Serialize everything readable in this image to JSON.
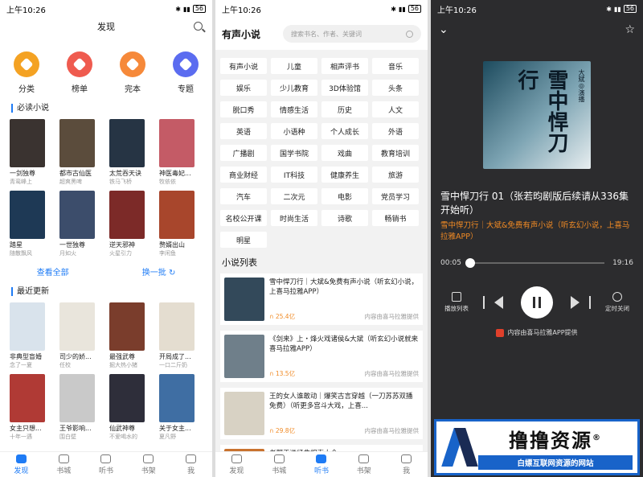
{
  "status_time": "上午10:26",
  "battery": "56",
  "discover": {
    "title": "发现",
    "categories": [
      {
        "label": "分类",
        "color": "#f4a223"
      },
      {
        "label": "榜单",
        "color": "#ef5b4f"
      },
      {
        "label": "完本",
        "color": "#f6893a"
      },
      {
        "label": "专题",
        "color": "#5b6cf0"
      }
    ],
    "must_read_title": "必读小说",
    "must_read": [
      {
        "title": "一剑独尊",
        "author": "青鸾峰上",
        "color": "#3a3330"
      },
      {
        "title": "都市古仙医",
        "author": "超爽黑啤",
        "color": "#5b4c3c"
      },
      {
        "title": "太荒吞天诀",
        "author": "铁马飞桥",
        "color": "#263444"
      },
      {
        "title": "神医毒妃...",
        "author": "牧依依",
        "color": "#c45b66"
      },
      {
        "title": "踏星",
        "author": "随散飘风",
        "color": "#1e3955"
      },
      {
        "title": "一世独尊",
        "author": "月如火",
        "color": "#3c4d6b"
      },
      {
        "title": "逆天邪神",
        "author": "火星引力",
        "color": "#7c2a28"
      },
      {
        "title": "赘婿出山",
        "author": "李闲鱼",
        "color": "#a8462c"
      }
    ],
    "view_all": "查看全部",
    "refresh": "换一批",
    "recent_title": "最近更新",
    "recent": [
      {
        "title": "非典型盲婚",
        "author": "念了一夏",
        "color": "#d9e3ec"
      },
      {
        "title": "司少的娇...",
        "author": "任校",
        "color": "#e9e5dc"
      },
      {
        "title": "最强武尊",
        "author": "掘大热小猪",
        "color": "#7a3d2c"
      },
      {
        "title": "开局成了...",
        "author": "一口二斤奶",
        "color": "#e4ddd0"
      },
      {
        "title": "女主只想...",
        "author": "十年一遇",
        "color": "#b03a35"
      },
      {
        "title": "王爷影响...",
        "author": "围白壁",
        "color": "#c9c9c9"
      },
      {
        "title": "仙武神尊",
        "author": "不爱喝水的",
        "color": "#2e2e3a"
      },
      {
        "title": "关于女主...",
        "author": "夏凡野",
        "color": "#3f6ea3"
      }
    ]
  },
  "audio": {
    "title": "有声小说",
    "search_placeholder": "搜索书名、作者、关键词",
    "chips": [
      "有声小说",
      "儿童",
      "相声评书",
      "音乐",
      "娱乐",
      "少儿教育",
      "3D体验馆",
      "头条",
      "脱口秀",
      "情感生活",
      "历史",
      "人文",
      "英语",
      "小语种",
      "个人成长",
      "外语",
      "广播剧",
      "国学书院",
      "戏曲",
      "教育培训",
      "商业财经",
      "IT科技",
      "健康养生",
      "旅游",
      "汽车",
      "二次元",
      "电影",
      "党员学习",
      "名校公开课",
      "时尚生活",
      "诗歌",
      "畅销书",
      "明星"
    ],
    "list_title": "小说列表",
    "items": [
      {
        "title": "雪中悍刀行｜大斌&免费有声小说（听玄幻小说，上喜马拉雅APP）",
        "plays": "25.4亿",
        "source": "内容由喜马拉雅提供",
        "color": "#33495a"
      },
      {
        "title": "《剑来》上・烽火戏诸侯&大斌（听玄幻小说就来喜马拉雅APP）",
        "plays": "13.5亿",
        "source": "内容由喜马拉雅提供",
        "color": "#6f7f8a"
      },
      {
        "title": "王的女人谁敢动｜爆笑古言穿越（一刀苏苏双播免费）（听更多宫斗大戏，上喜...",
        "plays": "29.8亿",
        "source": "内容由喜马拉雅提供",
        "color": "#d8d2c4"
      },
      {
        "title": "老郭于谦经典相声大全",
        "plays": "",
        "source": "",
        "color": "#c9732f"
      }
    ]
  },
  "player": {
    "cover_text": "雪中悍刀行",
    "cover_side": "大斌◎演播",
    "title": "雪中悍刀行 01（张若昀剧版后续请从336集开始听）",
    "subtitle": "雪中悍刀行｜大斌&免费有声小说（听玄幻小说，上喜马拉雅APP）",
    "elapsed": "00:05",
    "duration": "19:16",
    "progress_fraction": 0.004,
    "playlist_label": "播放列表",
    "timer_label": "定时关闭",
    "provider": "内容由喜马拉雅APP提供"
  },
  "tabs": [
    {
      "label": "发现"
    },
    {
      "label": "书城"
    },
    {
      "label": "听书"
    },
    {
      "label": "书架"
    },
    {
      "label": "我"
    }
  ],
  "watermark": {
    "main": "撸撸资源",
    "mark": "®",
    "tagline": "白嫖互联网资源的网站"
  }
}
